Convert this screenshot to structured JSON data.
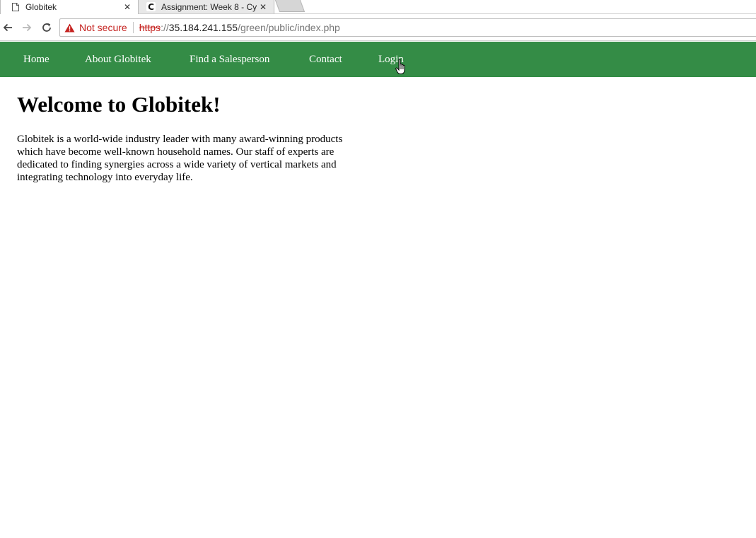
{
  "browser": {
    "tabs": [
      {
        "title": "Globitek",
        "close_label": "✕",
        "active": true,
        "icon": "page-icon"
      },
      {
        "title": "Assignment: Week 8 - Cy",
        "close_label": "✕",
        "active": false,
        "icon": "c-favicon-icon",
        "icon_glyph": "C"
      }
    ],
    "address": {
      "security_label": "Not secure",
      "scheme": "https",
      "host_separator": "://",
      "host": "35.184.241.155",
      "path": "/green/public/index.php"
    }
  },
  "site": {
    "nav": {
      "items": [
        {
          "label": "Home"
        },
        {
          "label": "About Globitek"
        },
        {
          "label": "Find a Salesperson"
        },
        {
          "label": "Contact"
        },
        {
          "label": "Login"
        }
      ]
    },
    "heading": "Welcome to Globitek!",
    "intro": "Globitek is a world-wide industry leader with many award-winning products which have become well-known household names. Our staff of experts are dedicated to finding synergies across a wide variety of vertical markets and integrating technology into everyday life."
  },
  "colors": {
    "nav_background": "#348c46",
    "not_secure_red": "#c5221f"
  }
}
